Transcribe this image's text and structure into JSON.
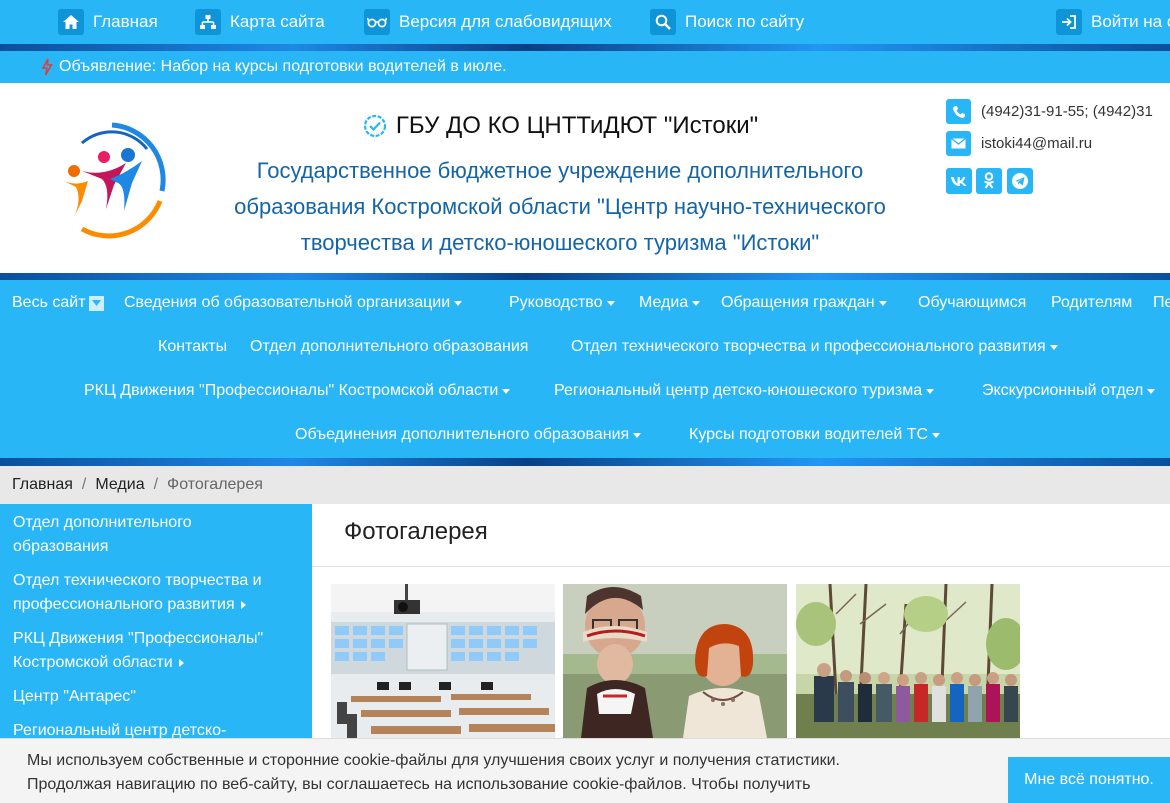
{
  "topbar": {
    "home_label": "Главная",
    "sitemap_label": "Карта сайта",
    "accessibility_label": "Версия для слабовидящих",
    "search_label": "Поиск по сайту",
    "login_label": "Войти на с"
  },
  "announcement": {
    "text": "Объявление: Набор на курсы подготовки водителей в июле."
  },
  "header": {
    "short_name": "ГБУ ДО КО ЦНТТиДЮТ \"Истоки\"",
    "full_name_line1": "Государственное бюджетное учреждение дополнительного",
    "full_name_line2": "образования Костромской области \"Центр научно-технического",
    "full_name_line3": "творчества и детско-юношеского туризма \"Истоки\"",
    "phone": "(4942)31-91-55; (4942)31",
    "email": "istoki44@mail.ru",
    "social": {
      "vk": "vk",
      "ok": "ok",
      "telegram": "telegram"
    }
  },
  "menu": {
    "row1": [
      "Весь сайт",
      "Сведения об образовательной организации",
      "Руководство",
      "Медиа",
      "Обращения граждан",
      "Обучающимся",
      "Родителям",
      "Пе"
    ],
    "row2": [
      "Контакты",
      "Отдел дополнительного образования",
      "Отдел технического творчества и профессионального развития"
    ],
    "row3": [
      "РКЦ Движения \"Профессионалы\" Костромской области",
      "Региональный центр детско-юношеского туризма",
      "Экскурсионный отдел"
    ],
    "row4": [
      "Объединения дополнительного образования",
      "Курсы подготовки водителей ТС"
    ]
  },
  "breadcrumb": {
    "home": "Главная",
    "media": "Медиа",
    "current": "Фотогалерея",
    "separator": "/"
  },
  "sidebar": {
    "items": [
      {
        "line1": "Отдел дополнительного",
        "line2": "образования"
      },
      {
        "line1": "Отдел технического творчества и",
        "line2": "профессионального развития"
      },
      {
        "line1": "РКЦ Движения \"Профессионалы\"",
        "line2": "Костромской области"
      },
      {
        "line1": "Центр \"Антарес\"",
        "line2": ""
      },
      {
        "line1": "Региональный центр детско-",
        "line2": ""
      }
    ]
  },
  "main": {
    "title": "Фотогалерея"
  },
  "cookie": {
    "line1": "Мы используем собственные и сторонние cookie-файлы для улучшения своих услуг и получения статистики.",
    "line2": "Продолжая навигацию по веб-сайту, вы соглашаетесь на использование cookie-файлов. Чтобы получить",
    "accept_label": "Мне всё понятно."
  },
  "colors": {
    "accent": "#29b6f6",
    "dark_blue": "#1565a6"
  }
}
